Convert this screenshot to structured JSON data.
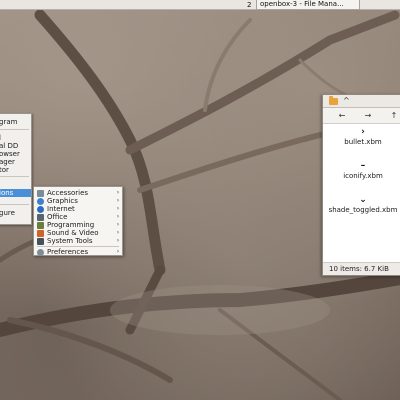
{
  "panel": {
    "desktop_number": "2",
    "task_title": "openbox-3 - File Mana..."
  },
  "root_menu": {
    "items": [
      {
        "label": "gram"
      },
      {
        "label": "l"
      },
      {
        "label": "al DD"
      },
      {
        "label": "owser"
      },
      {
        "label": "ager"
      },
      {
        "label": "tor"
      },
      {
        "label": "ions",
        "active": true
      },
      {
        "label": ""
      },
      {
        "label": "gure"
      }
    ]
  },
  "apps_menu": {
    "items": [
      {
        "label": "Accessories",
        "icon": "accessories-icon",
        "color": "#7a8b99",
        "arrow": "›"
      },
      {
        "label": "Graphics",
        "icon": "graphics-icon",
        "color": "#3f7fcf",
        "arrow": "›"
      },
      {
        "label": "Internet",
        "icon": "internet-icon",
        "color": "#2e6bbf",
        "arrow": "›"
      },
      {
        "label": "Office",
        "icon": "office-icon",
        "color": "#5a6470",
        "arrow": "›"
      },
      {
        "label": "Programming",
        "icon": "programming-icon",
        "color": "#6b7d3c",
        "arrow": "›"
      },
      {
        "label": "Sound & Video",
        "icon": "sound-video-icon",
        "color": "#d0632a",
        "arrow": "›"
      },
      {
        "label": "System Tools",
        "icon": "system-tools-icon",
        "color": "#44505c",
        "arrow": "›"
      },
      {
        "label": "Preferences",
        "icon": "preferences-icon",
        "color": "#7f8c98",
        "arrow": "›"
      }
    ]
  },
  "file_manager": {
    "nav": {
      "back": "←",
      "forward": "→",
      "up": "↑"
    },
    "files": [
      {
        "glyph": "›",
        "name": "bullet.xbm"
      },
      {
        "glyph": "–",
        "name": "iconify.xbm"
      },
      {
        "glyph": "⌄",
        "name": "shade_toggled.xbm"
      }
    ],
    "status": "10 items: 6.7 KiB"
  }
}
